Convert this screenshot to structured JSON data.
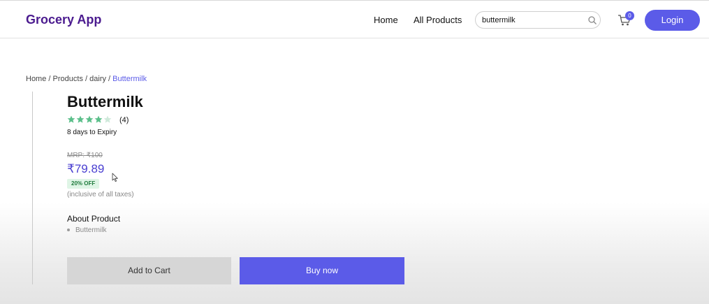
{
  "header": {
    "logo": "Grocery App",
    "nav": [
      {
        "label": "Home"
      },
      {
        "label": "All Products"
      }
    ],
    "search": {
      "value": "buttermilk",
      "placeholder": "",
      "icon": "search-icon"
    },
    "cart": {
      "icon": "cart-icon",
      "count": "0"
    },
    "login_label": "Login"
  },
  "breadcrumb": {
    "items": [
      "Home",
      "Products",
      "dairy"
    ],
    "separator": "/",
    "current": "Buttermilk"
  },
  "product": {
    "name": "Buttermilk",
    "rating": 4,
    "rating_max": 5,
    "rating_count": "(4)",
    "expiry": "8 days to Expiry",
    "mrp": "MRP: ₹100",
    "price": "₹79.89",
    "discount": "20% OFF",
    "tax_note": "(inclusive of all taxes)",
    "about_heading": "About Product",
    "about_items": [
      "Buttermilk"
    ]
  },
  "actions": {
    "add_to_cart": "Add to Cart",
    "buy_now": "Buy now"
  },
  "colors": {
    "brand": "#4b1b8f",
    "accent": "#5b5be8",
    "star": "#5bbf8a",
    "star_empty": "#cfe9da"
  }
}
